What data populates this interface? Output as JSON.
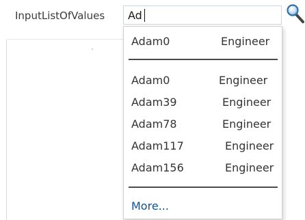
{
  "field": {
    "label": "InputListOfValues",
    "value": "Ad"
  },
  "search_icon": "magnifier-icon",
  "dropdown": {
    "recent": [
      {
        "name": "Adam0",
        "role": "Engineer"
      }
    ],
    "results": [
      {
        "name": "Adam0",
        "role": "Engineer"
      },
      {
        "name": "Adam39",
        "role": "Engineer"
      },
      {
        "name": "Adam78",
        "role": "Engineer"
      },
      {
        "name": "Adam117",
        "role": "Engineer"
      },
      {
        "name": "Adam156",
        "role": "Engineer"
      }
    ],
    "more_label": "More..."
  }
}
